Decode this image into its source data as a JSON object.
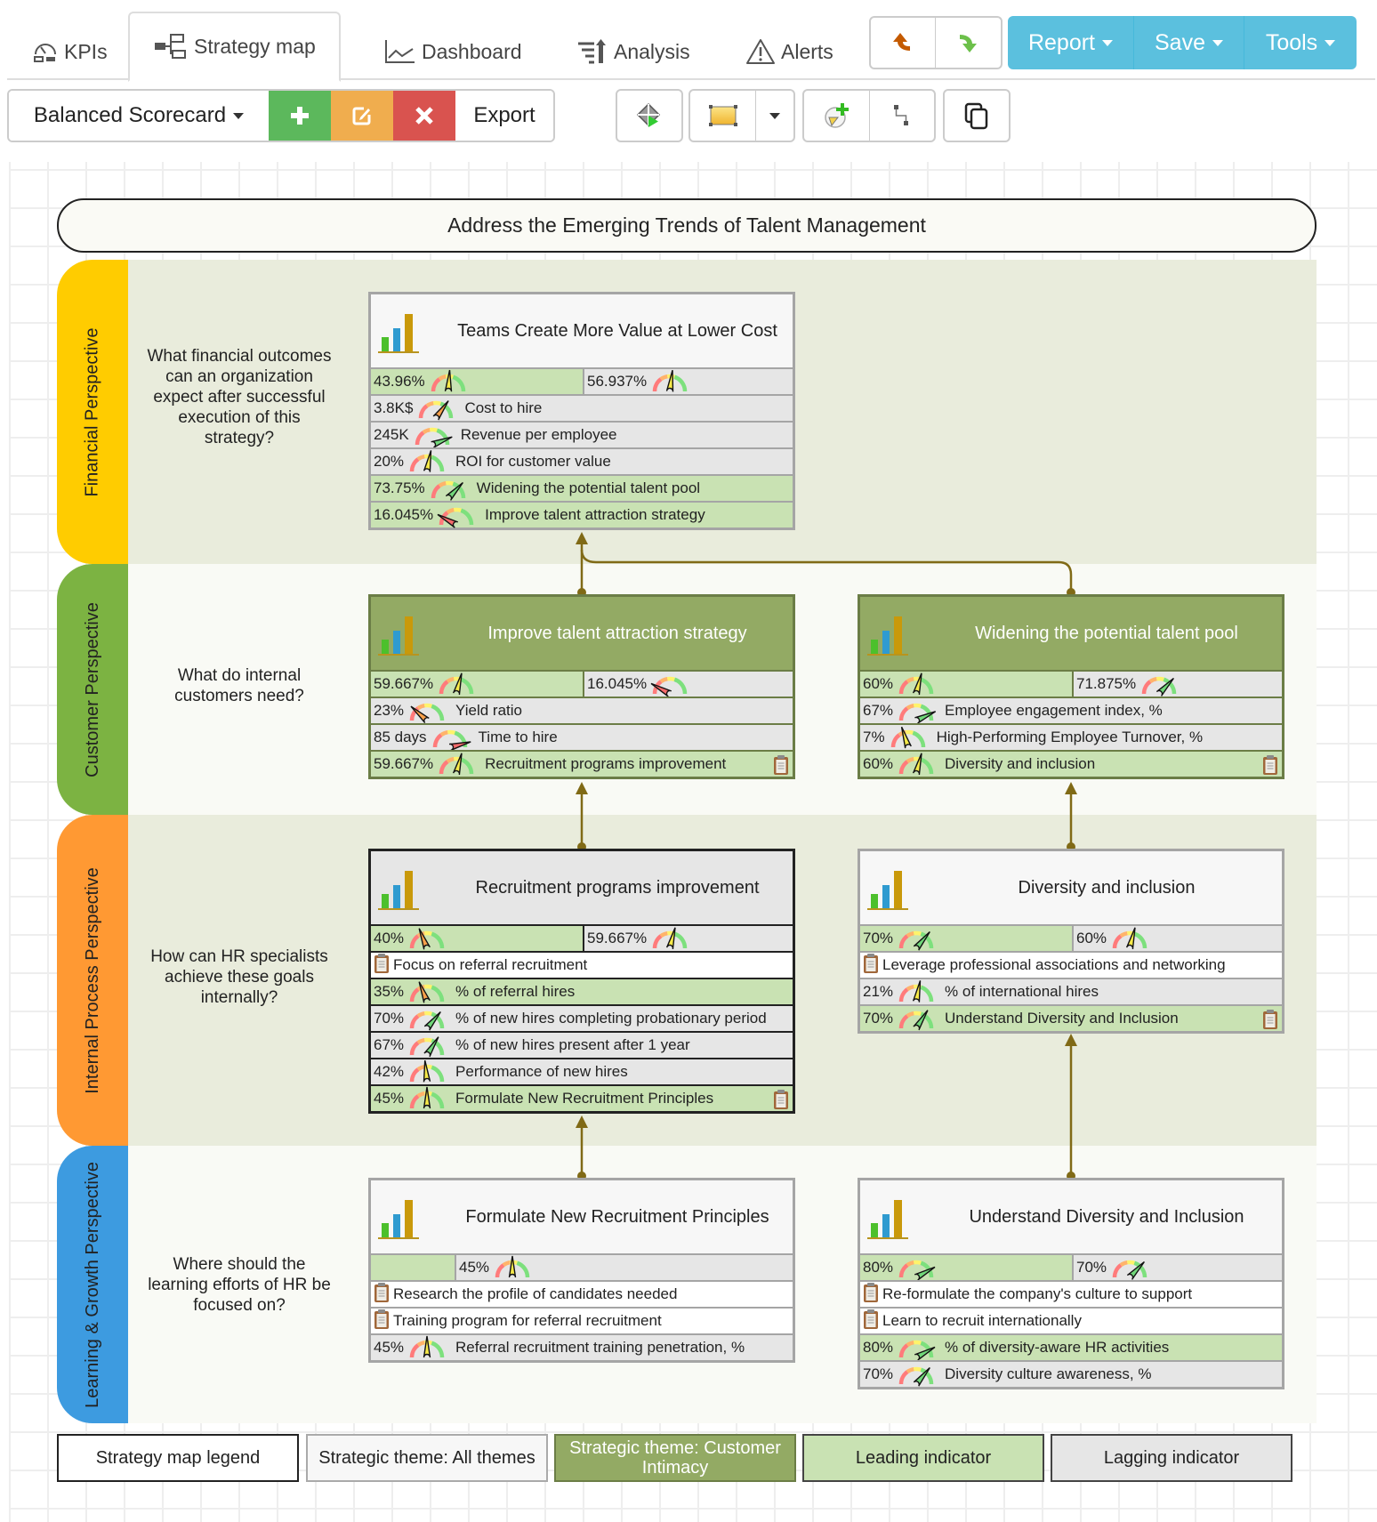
{
  "tabs": [
    {
      "label": "KPIs",
      "icon": "gauge-icon"
    },
    {
      "label": "Strategy map",
      "icon": "hierarchy-icon",
      "active": true
    },
    {
      "label": "Dashboard",
      "icon": "line-chart-icon"
    },
    {
      "label": "Analysis",
      "icon": "sort-analysis-icon"
    },
    {
      "label": "Alerts",
      "icon": "warning-icon"
    }
  ],
  "toolbar": {
    "undo_icon": "undo-icon",
    "redo_icon": "redo-icon",
    "report_label": "Report",
    "save_label": "Save",
    "tools_label": "Tools",
    "scorecard_select": "Balanced Scorecard",
    "add_icon": "plus-icon",
    "edit_icon": "edit-icon",
    "delete_icon": "close-icon",
    "export_label": "Export",
    "colors": {
      "add": "#5cb85c",
      "edit": "#f0ad4e",
      "delete": "#d9534f",
      "primary": "#5bc0de"
    }
  },
  "map": {
    "title": "Address the Emerging Trends of Talent Management",
    "lanes": [
      {
        "name": "Financial Perspective",
        "color": "#ffcc00",
        "bg": "#e9ecdc",
        "question": "What financial outcomes can an organization expect after successful execution of this strategy?"
      },
      {
        "name": "Customer Perspective",
        "color": "#7cb342",
        "bg": "#f9faf5",
        "question": "What do internal customers need?"
      },
      {
        "name": "Internal Process Perspective",
        "color": "#ff9933",
        "bg": "#e9ecdc",
        "question": "How can HR specialists achieve these goals internally?"
      },
      {
        "name": "Learning & Growth Perspective",
        "color": "#3d9be0",
        "bg": "#f9faf5",
        "question": "Where should the learning efforts of HR be focused on?"
      }
    ],
    "objectives": {
      "teams": {
        "title": "Teams Create More Value at Lower Cost",
        "summary": {
          "left": "43.96%",
          "right": "56.937%"
        },
        "rows": [
          {
            "value": "3.8K$",
            "label": "Cost to hire",
            "type": "lag"
          },
          {
            "value": "245K",
            "label": "Revenue per employee",
            "type": "lag"
          },
          {
            "value": "20%",
            "label": "ROI for customer value",
            "type": "lag"
          },
          {
            "value": "73.75%",
            "label": "Widening the potential talent pool",
            "type": "lead"
          },
          {
            "value": "16.045%",
            "label": "Improve talent attraction strategy",
            "type": "lead"
          }
        ]
      },
      "attraction": {
        "title": "Improve talent attraction strategy",
        "summary": {
          "left": "59.667%",
          "right": "16.045%"
        },
        "rows": [
          {
            "value": "23%",
            "label": "Yield ratio",
            "type": "lag"
          },
          {
            "value": "85 days",
            "label": "Time to hire",
            "type": "lag"
          },
          {
            "value": "59.667%",
            "label": "Recruitment programs improvement",
            "type": "lead"
          }
        ]
      },
      "widening": {
        "title": "Widening the potential talent pool",
        "summary": {
          "left": "60%",
          "right": "71.875%"
        },
        "rows": [
          {
            "value": "67%",
            "label": "Employee engagement index, %",
            "type": "lag"
          },
          {
            "value": "7%",
            "label": "High-Performing Employee Turnover, %",
            "type": "lag"
          },
          {
            "value": "60%",
            "label": "Diversity and inclusion",
            "type": "lead"
          }
        ]
      },
      "recruitment": {
        "title": "Recruitment programs improvement",
        "summary": {
          "left": "40%",
          "right": "59.667%"
        },
        "initiative": "Focus on referral recruitment",
        "rows": [
          {
            "value": "35%",
            "label": "% of referral hires",
            "type": "lead"
          },
          {
            "value": "70%",
            "label": "% of new hires completing probationary period",
            "type": "lag"
          },
          {
            "value": "67%",
            "label": "% of new hires present after 1 year",
            "type": "lag"
          },
          {
            "value": "42%",
            "label": "Performance of new hires",
            "type": "lag"
          },
          {
            "value": "45%",
            "label": "Formulate New Recruitment Principles",
            "type": "lead"
          }
        ]
      },
      "diversity": {
        "title": "Diversity and inclusion",
        "summary": {
          "left": "70%",
          "right": "60%"
        },
        "initiative": "Leverage professional associations and networking",
        "rows": [
          {
            "value": "21%",
            "label": "% of international hires",
            "type": "lag"
          },
          {
            "value": "70%",
            "label": "Understand Diversity and Inclusion",
            "type": "lead"
          }
        ]
      },
      "formulate": {
        "title": "Formulate New Recruitment Principles",
        "summary": {
          "left": "",
          "right": "45%"
        },
        "initiatives": [
          "Research the profile of candidates needed",
          "Training program for referral recruitment"
        ],
        "rows": [
          {
            "value": "45%",
            "label": "Referral recruitment training penetration, %",
            "type": "lag"
          }
        ]
      },
      "understand": {
        "title": "Understand Diversity and Inclusion",
        "summary": {
          "left": "80%",
          "right": "70%"
        },
        "initiatives": [
          "Re-formulate the company's culture to support",
          "Learn to recruit internationally"
        ],
        "rows": [
          {
            "value": "80%",
            "label": "% of diversity-aware HR activities",
            "type": "lead"
          },
          {
            "value": "70%",
            "label": "Diversity culture awareness, %",
            "type": "lag"
          }
        ]
      }
    }
  },
  "legend": [
    {
      "label": "Strategy map legend"
    },
    {
      "label": "Strategic theme: All themes"
    },
    {
      "label": "Strategic theme: Customer Intimacy"
    },
    {
      "label": "Leading indicator"
    },
    {
      "label": "Lagging indicator"
    }
  ]
}
